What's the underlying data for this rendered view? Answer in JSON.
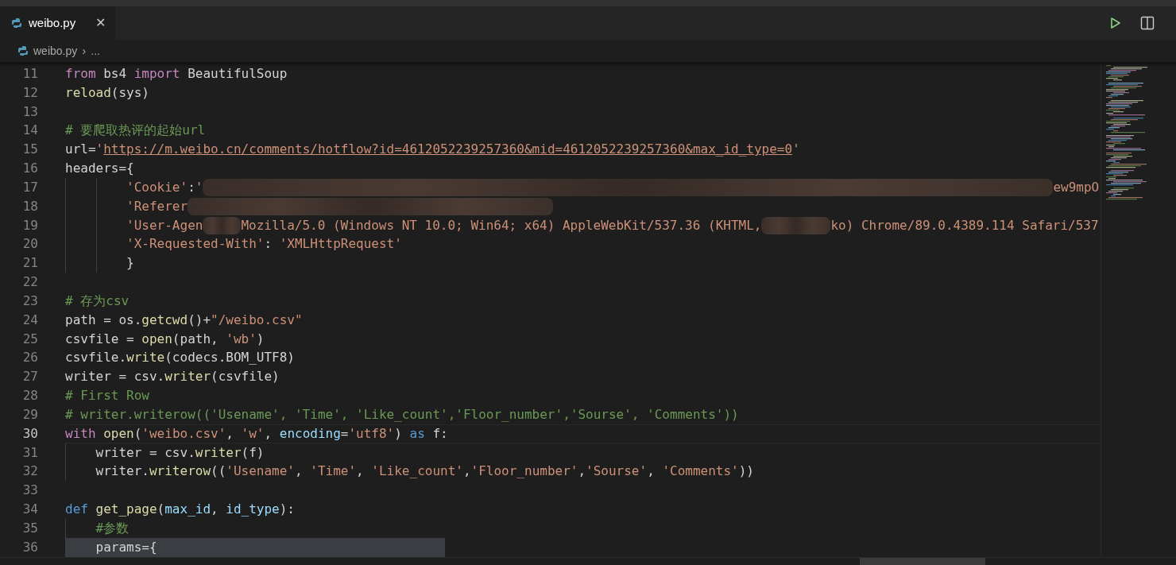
{
  "tab": {
    "label": "weibo.py",
    "selected": true,
    "close": "✕"
  },
  "breadcrumb": {
    "file": "weibo.py",
    "separator": "›",
    "more": "..."
  },
  "editor": {
    "lines": [
      {
        "number": "11",
        "current": false,
        "highlighted": false,
        "tokens": [
          {
            "kind": "keyword",
            "text": "from"
          },
          {
            "kind": "plain",
            "text": " bs4 "
          },
          {
            "kind": "keyword",
            "text": "import"
          },
          {
            "kind": "plain",
            "text": " BeautifulSoup"
          }
        ]
      },
      {
        "number": "12",
        "current": false,
        "highlighted": false,
        "tokens": [
          {
            "kind": "function",
            "text": "reload"
          },
          {
            "kind": "plain",
            "text": "(sys)"
          }
        ]
      },
      {
        "number": "13",
        "current": false,
        "highlighted": false
      },
      {
        "number": "14",
        "current": false,
        "highlighted": false,
        "tokens": [
          {
            "kind": "comment",
            "text": "# 要爬取热评的起始url"
          }
        ]
      },
      {
        "number": "15",
        "current": false,
        "highlighted": false,
        "tokens": [
          {
            "kind": "plain",
            "text": "url="
          },
          {
            "kind": "string",
            "text": "'"
          },
          {
            "kind": "link",
            "text": "https://m.weibo.cn/comments/hotflow?id=4612052239257360&mid=4612052239257360&max_id_type=0"
          },
          {
            "kind": "string",
            "text": "'"
          }
        ]
      },
      {
        "number": "16",
        "current": false,
        "highlighted": false,
        "tokens": [
          {
            "kind": "plain",
            "text": "headers={"
          }
        ]
      },
      {
        "number": "17",
        "current": false,
        "highlighted": false,
        "tokens": [
          {
            "kind": "string",
            "text": "        'Cookie'"
          },
          {
            "kind": "plain",
            "text": ":"
          },
          {
            "kind": "string",
            "text": "'"
          },
          {
            "kind": "redacted"
          },
          {
            "kind": "string",
            "text": "ew9mpO"
          }
        ]
      },
      {
        "number": "18",
        "current": false,
        "highlighted": false,
        "tokens": [
          {
            "kind": "string",
            "text": "        'Referer"
          },
          {
            "kind": "redacted"
          }
        ]
      },
      {
        "number": "19",
        "current": false,
        "highlighted": false,
        "tokens": [
          {
            "kind": "string",
            "text": "        'User-Agen"
          },
          {
            "kind": "redacted"
          },
          {
            "kind": "string",
            "text": "Mozilla/5.0 (Windows NT 10.0; Win64; x64) AppleWebKit/537.36 (KHTML,"
          },
          {
            "kind": "redacted"
          },
          {
            "kind": "string",
            "text": "ko) Chrome/89.0.4389.114 Safari/537"
          }
        ]
      },
      {
        "number": "20",
        "current": false,
        "highlighted": false,
        "tokens": [
          {
            "kind": "string",
            "text": "        'X-Requested-With'"
          },
          {
            "kind": "plain",
            "text": ": "
          },
          {
            "kind": "string",
            "text": "'XMLHttpRequest'"
          }
        ]
      },
      {
        "number": "21",
        "current": false,
        "highlighted": false,
        "tokens": [
          {
            "kind": "plain",
            "text": "        }"
          }
        ]
      },
      {
        "number": "22",
        "current": false,
        "highlighted": false
      },
      {
        "number": "23",
        "current": false,
        "highlighted": false,
        "tokens": [
          {
            "kind": "comment",
            "text": "# 存为csv"
          }
        ]
      },
      {
        "number": "24",
        "current": false,
        "highlighted": false,
        "tokens": [
          {
            "kind": "plain",
            "text": "path = os."
          },
          {
            "kind": "function",
            "text": "getcwd"
          },
          {
            "kind": "plain",
            "text": "()+"
          },
          {
            "kind": "string",
            "text": "\"/weibo.csv\""
          }
        ]
      },
      {
        "number": "25",
        "current": false,
        "highlighted": false,
        "tokens": [
          {
            "kind": "plain",
            "text": "csvfile = "
          },
          {
            "kind": "function",
            "text": "open"
          },
          {
            "kind": "plain",
            "text": "(path, "
          },
          {
            "kind": "string",
            "text": "'wb'"
          },
          {
            "kind": "plain",
            "text": ")"
          }
        ]
      },
      {
        "number": "26",
        "current": false,
        "highlighted": false,
        "tokens": [
          {
            "kind": "plain",
            "text": "csvfile."
          },
          {
            "kind": "function",
            "text": "write"
          },
          {
            "kind": "plain",
            "text": "(codecs.BOM_UTF8)"
          }
        ]
      },
      {
        "number": "27",
        "current": false,
        "highlighted": false,
        "tokens": [
          {
            "kind": "plain",
            "text": "writer = csv."
          },
          {
            "kind": "function",
            "text": "writer"
          },
          {
            "kind": "plain",
            "text": "(csvfile)"
          }
        ]
      },
      {
        "number": "28",
        "current": false,
        "highlighted": false,
        "tokens": [
          {
            "kind": "comment",
            "text": "# First Row"
          }
        ]
      },
      {
        "number": "29",
        "current": false,
        "highlighted": false,
        "tokens": [
          {
            "kind": "comment",
            "text": "# writer.writerow(('Usename', 'Time', 'Like_count','Floor_number','Sourse', 'Comments'))"
          }
        ]
      },
      {
        "number": "30",
        "current": true,
        "highlighted": false,
        "tokens": [
          {
            "kind": "keyword",
            "text": "with "
          },
          {
            "kind": "function",
            "text": "open"
          },
          {
            "kind": "plain",
            "text": "("
          },
          {
            "kind": "string",
            "text": "'weibo.csv'"
          },
          {
            "kind": "plain",
            "text": ", "
          },
          {
            "kind": "string",
            "text": "'w'"
          },
          {
            "kind": "plain",
            "text": ", "
          },
          {
            "kind": "param",
            "text": "encoding"
          },
          {
            "kind": "plain",
            "text": "="
          },
          {
            "kind": "string",
            "text": "'utf8'"
          },
          {
            "kind": "plain",
            "text": ") "
          },
          {
            "kind": "storage",
            "text": "as"
          },
          {
            "kind": "plain",
            "text": " f:"
          }
        ]
      },
      {
        "number": "31",
        "current": false,
        "highlighted": false,
        "tokens": [
          {
            "kind": "plain",
            "text": "    writer = csv."
          },
          {
            "kind": "function",
            "text": "writer"
          },
          {
            "kind": "plain",
            "text": "(f)"
          }
        ]
      },
      {
        "number": "32",
        "current": false,
        "highlighted": false,
        "tokens": [
          {
            "kind": "plain",
            "text": "    writer."
          },
          {
            "kind": "function",
            "text": "writerow"
          },
          {
            "kind": "plain",
            "text": "(("
          },
          {
            "kind": "string",
            "text": "'Usename'"
          },
          {
            "kind": "plain",
            "text": ", "
          },
          {
            "kind": "string",
            "text": "'Time'"
          },
          {
            "kind": "plain",
            "text": ", "
          },
          {
            "kind": "string",
            "text": "'Like_count'"
          },
          {
            "kind": "plain",
            "text": ","
          },
          {
            "kind": "string",
            "text": "'Floor_number'"
          },
          {
            "kind": "plain",
            "text": ","
          },
          {
            "kind": "string",
            "text": "'Sourse'"
          },
          {
            "kind": "plain",
            "text": ", "
          },
          {
            "kind": "string",
            "text": "'Comments'"
          },
          {
            "kind": "plain",
            "text": "))"
          }
        ]
      },
      {
        "number": "33",
        "current": false,
        "highlighted": false
      },
      {
        "number": "34",
        "current": false,
        "highlighted": false,
        "tokens": [
          {
            "kind": "storage",
            "text": "def "
          },
          {
            "kind": "function",
            "text": "get_page"
          },
          {
            "kind": "plain",
            "text": "("
          },
          {
            "kind": "param",
            "text": "max_id"
          },
          {
            "kind": "plain",
            "text": ", "
          },
          {
            "kind": "param",
            "text": "id_type"
          },
          {
            "kind": "plain",
            "text": "):"
          }
        ]
      },
      {
        "number": "35",
        "current": false,
        "highlighted": false,
        "tokens": [
          {
            "kind": "comment",
            "text": "    #参数"
          }
        ]
      },
      {
        "number": "36",
        "current": false,
        "highlighted": true,
        "tokens": [
          {
            "kind": "plain",
            "text": "    params={"
          }
        ]
      }
    ]
  }
}
